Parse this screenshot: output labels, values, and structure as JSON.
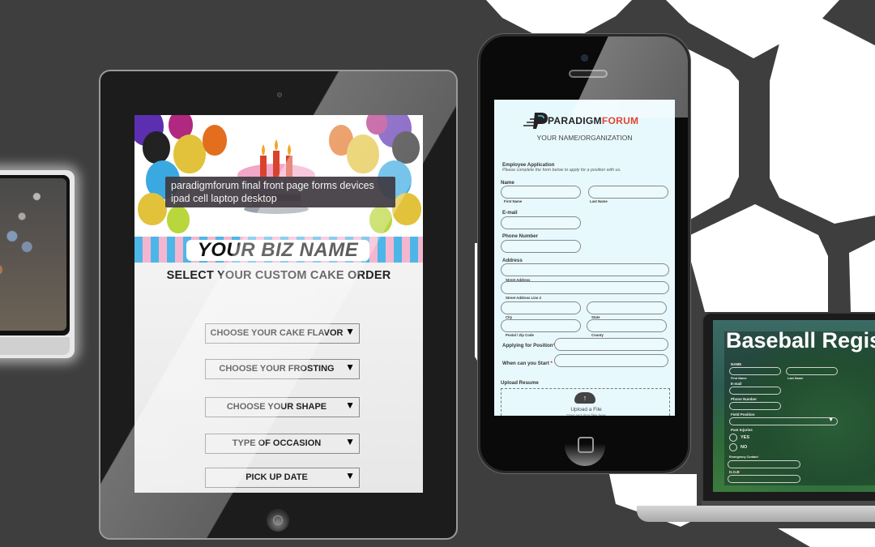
{
  "tooltip": {
    "line1": "paradigmforum final front page forms devices",
    "line2": "ipad cell laptop desktop"
  },
  "ipad": {
    "biz_name": "YOUR BIZ NAME",
    "title": "SELECT YOUR CUSTOM CAKE ORDER",
    "dropdowns": [
      {
        "label": "CHOOSE YOUR CAKE FLAVOR"
      },
      {
        "label": "CHOOSE YOUR FROSTING"
      },
      {
        "label": "CHOOSE YOUR SHAPE"
      },
      {
        "label": "TYPE OF OCCASION"
      },
      {
        "label": "PICK UP DATE"
      }
    ],
    "dropdown_arrow": "▼"
  },
  "phone": {
    "logo_left": "PARADIGM",
    "logo_right": "FORUM",
    "org": "YOUR NAME/ORGANIZATION",
    "form_title": "Employee Application",
    "form_desc": "Please complete the form below to apply for a position with us.",
    "labels": {
      "name": "Name",
      "first_name": "First Name",
      "last_name": "Last Name",
      "email": "E-mail",
      "phone": "Phone Number",
      "address": "Address",
      "street": "Street Address",
      "street2": "Street Address Line 2",
      "city": "City",
      "state": "State",
      "postal": "Postal / Zip Code",
      "county": "County",
      "position": "Applying for Position",
      "start": "When can you Start",
      "required_mark": "*",
      "upload_resume": "Upload Resume",
      "upload_file": "Upload a File",
      "drag_drop": "Drag and drop files here"
    }
  },
  "laptop": {
    "title": "Baseball Registr",
    "labels": {
      "name": "NAME",
      "first_name": "First Name",
      "last_name": "Last Name",
      "email": "E-mail",
      "phone": "Phone Number",
      "field_position": "Field Position",
      "past_injuries": "Past Injuries",
      "yes": "YES",
      "no": "NO",
      "emergency": "Emergency Contact",
      "dob": "D.O.B",
      "required_mark": "*"
    }
  },
  "colors": {
    "background": "#3e3e3e",
    "hex": "#ffffff",
    "accent_red": "#e04430",
    "phone_form_bg": "#e8f9fd",
    "awning_blue": "#4db6e8",
    "awning_pink": "#f4b6cf"
  }
}
